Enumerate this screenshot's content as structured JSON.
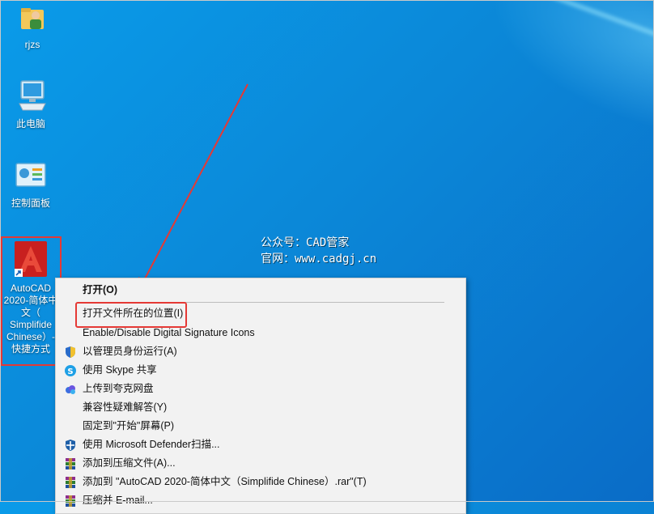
{
  "desktop": {
    "icons": [
      {
        "name": "folder-user-icon",
        "label": "rjzs"
      },
      {
        "name": "computer-icon",
        "label": "此电脑"
      },
      {
        "name": "control-panel-icon",
        "label": "控制面板"
      },
      {
        "name": "autocad-shortcut-icon",
        "label_lines": [
          "AutoCAD",
          "2020-简体中",
          "文（",
          "Simplifide",
          "Chinese）-",
          "快捷方式"
        ]
      }
    ]
  },
  "watermark": {
    "line1": "公众号：CAD管家",
    "line2": "官网：www.cadgj.cn"
  },
  "context_menu": {
    "items": [
      {
        "label": "打开(O)",
        "icon": ""
      },
      {
        "label": "打开文件所在的位置(I)",
        "icon": ""
      },
      {
        "label": "Enable/Disable Digital Signature Icons",
        "icon": ""
      },
      {
        "label": "以管理员身份运行(A)",
        "icon": "shield-icon"
      },
      {
        "label": "使用 Skype 共享",
        "icon": "skype-icon"
      },
      {
        "label": "上传到夸克网盘",
        "icon": "cloud-icon"
      },
      {
        "label": "兼容性疑难解答(Y)",
        "icon": ""
      },
      {
        "label": "固定到\"开始\"屏幕(P)",
        "icon": ""
      },
      {
        "label": "使用 Microsoft Defender扫描...",
        "icon": "defender-icon"
      },
      {
        "label": "添加到压缩文件(A)...",
        "icon": "winrar-icon"
      },
      {
        "label": "添加到 \"AutoCAD 2020-简体中文（Simplifide Chinese）.rar\"(T)",
        "icon": "winrar-icon"
      },
      {
        "label": "压缩并 E-mail...",
        "icon": "winrar-icon"
      }
    ]
  },
  "colors": {
    "highlight": "#e53935",
    "desktop": "#0b88d8",
    "menu_bg": "#f2f2f2"
  }
}
